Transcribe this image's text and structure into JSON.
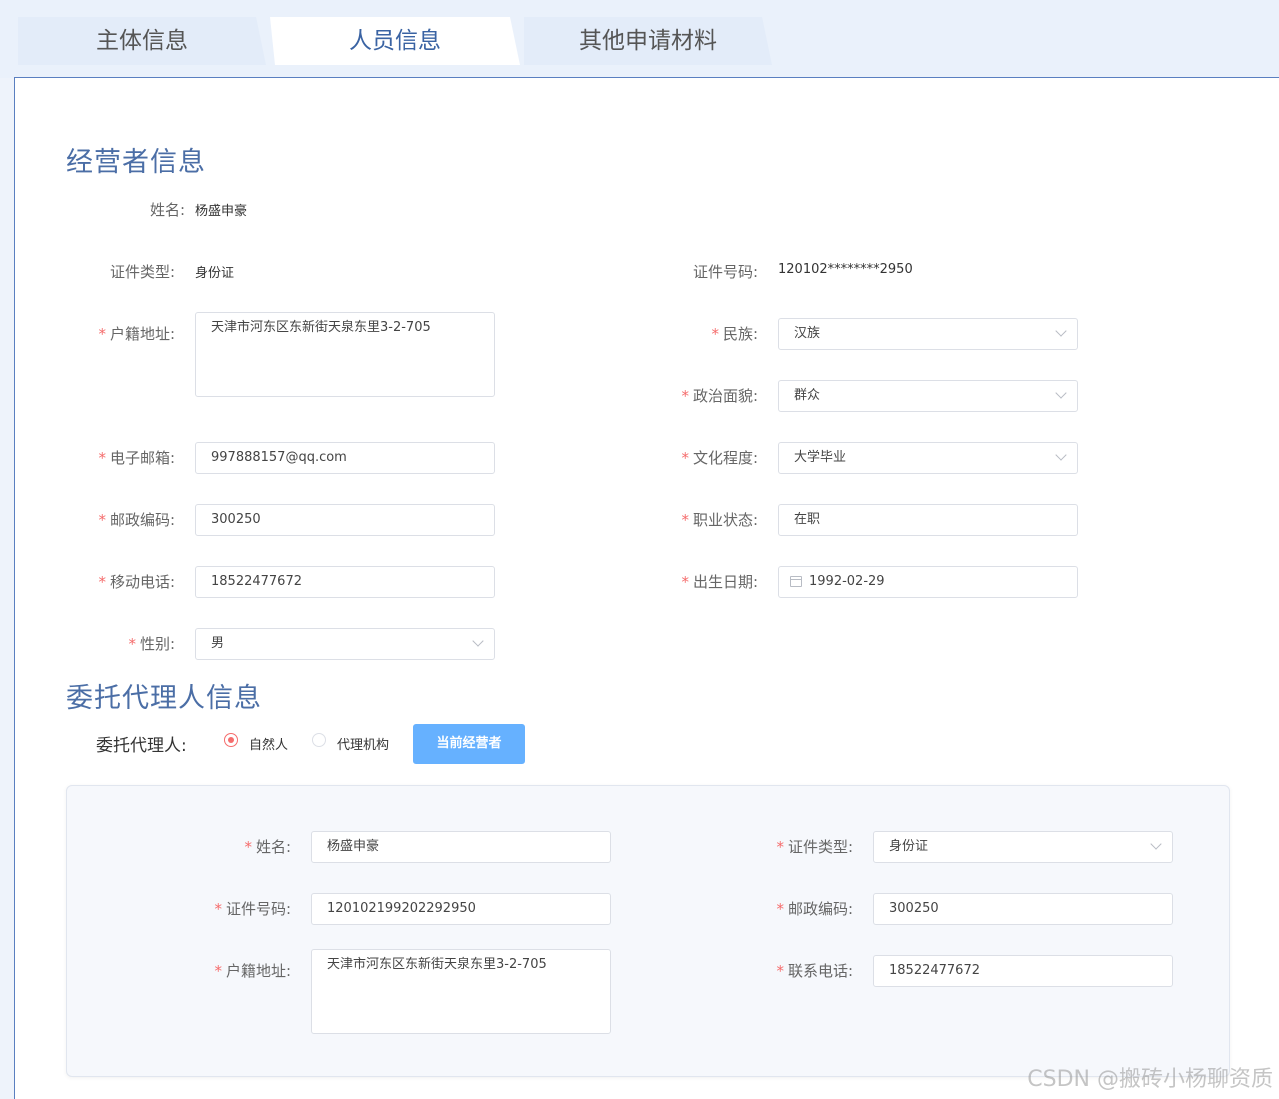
{
  "tabs": [
    {
      "label": "主体信息"
    },
    {
      "label": "人员信息"
    },
    {
      "label": "其他申请材料"
    }
  ],
  "operator": {
    "title": "经营者信息",
    "name_label": "姓名:",
    "name_value": "杨盛申豪",
    "id_type_label": "证件类型:",
    "id_type_value": "身份证",
    "id_number_label": "证件号码:",
    "id_number_value": "120102********2950",
    "address_label": "户籍地址:",
    "address_value": "天津市河东区东新街天泉东里3-2-705",
    "ethnicity_label": "民族:",
    "ethnicity_value": "汉族",
    "political_label": "政治面貌:",
    "political_value": "群众",
    "email_label": "电子邮箱:",
    "email_value": "997888157@qq.com",
    "education_label": "文化程度:",
    "education_value": "大学毕业",
    "postcode_label": "邮政编码:",
    "postcode_value": "300250",
    "job_status_label": "职业状态:",
    "job_status_value": "在职",
    "mobile_label": "移动电话:",
    "mobile_value": "18522477672",
    "birth_label": "出生日期:",
    "birth_value": "1992-02-29",
    "gender_label": "性别:",
    "gender_value": "男"
  },
  "agent": {
    "title": "委托代理人信息",
    "type_label": "委托代理人:",
    "option_natural": "自然人",
    "option_agency": "代理机构",
    "current_operator_button": "当前经营者",
    "name_label": "姓名:",
    "name_value": "杨盛申豪",
    "id_type_label": "证件类型:",
    "id_type_value": "身份证",
    "id_number_label": "证件号码:",
    "id_number_value": "120102199202292950",
    "postcode_label": "邮政编码:",
    "postcode_value": "300250",
    "address_label": "户籍地址:",
    "address_value": "天津市河东区东新街天泉东里3-2-705",
    "phone_label": "联系电话:",
    "phone_value": "18522477672"
  },
  "required_mark": "*",
  "watermark": "CSDN @搬砖小杨聊资质",
  "colors": {
    "accent": "#4b6ea6",
    "required": "#f56c6c",
    "button": "#66b1ff"
  }
}
